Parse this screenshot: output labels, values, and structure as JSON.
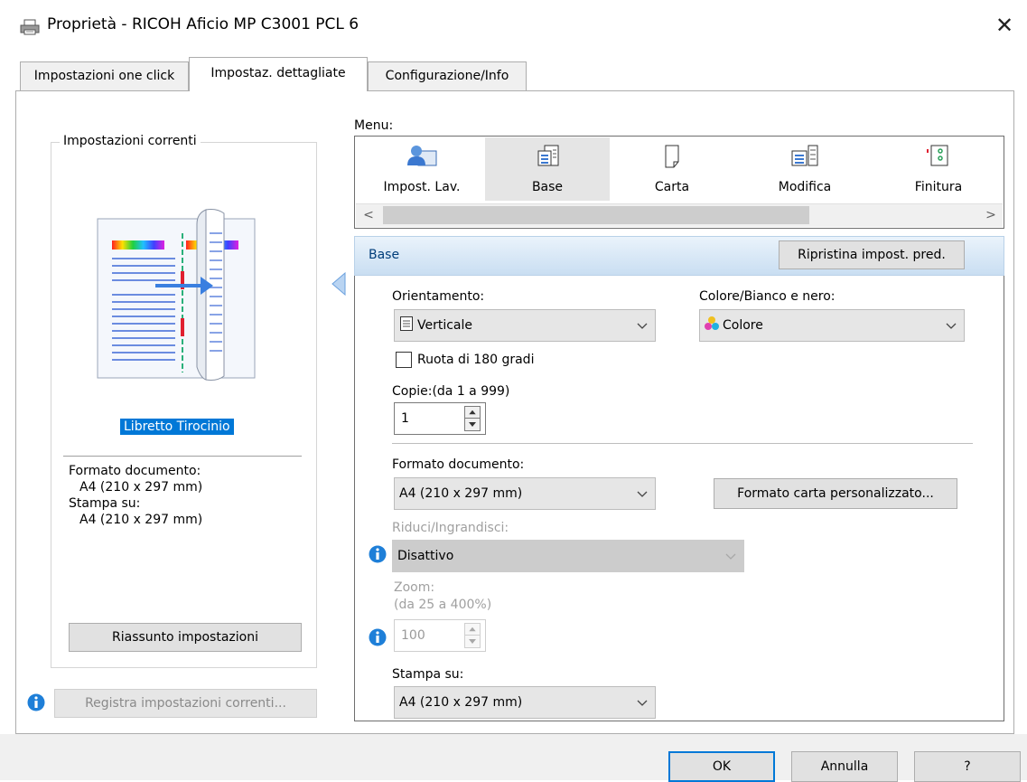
{
  "window": {
    "title": "Proprietà - RICOH Aficio MP C3001 PCL 6",
    "close_glyph": "✕"
  },
  "tabs": [
    {
      "label": "Impostazioni one click"
    },
    {
      "label": "Impostaz. dettagliate"
    },
    {
      "label": "Configurazione/Info"
    }
  ],
  "current_settings": {
    "legend": "Impostazioni correnti",
    "preset_name": "Libretto Tirocinio",
    "doc_size_label": "Formato documento:",
    "doc_size_value": "A4 (210 x 297 mm)",
    "print_on_label": "Stampa su:",
    "print_on_value": "A4 (210 x 297 mm)",
    "summary_button": "Riassunto impostazioni",
    "register_button": "Registra impostazioni correnti..."
  },
  "menu": {
    "label": "Menu:",
    "items": [
      {
        "label": "Impost. Lav.",
        "icon": "job-settings-icon"
      },
      {
        "label": "Base",
        "icon": "document-icon"
      },
      {
        "label": "Carta",
        "icon": "paper-icon"
      },
      {
        "label": "Modifica",
        "icon": "edit-icon"
      },
      {
        "label": "Finitura",
        "icon": "finishing-icon"
      }
    ],
    "scroll_left": "<",
    "scroll_right": ">"
  },
  "section": {
    "title": "Base",
    "reset_button": "Ripristina impost. pred."
  },
  "form": {
    "orientation_label": "Orientamento:",
    "orientation_value": "Verticale",
    "color_label": "Colore/Bianco e nero:",
    "color_value": "Colore",
    "rotate_label": "Ruota di 180 gradi",
    "copies_label": "Copie:(da 1 a 999)",
    "copies_value": "1",
    "doc_size_label": "Formato documento:",
    "doc_size_value": "A4 (210 x 297 mm)",
    "custom_size_button": "Formato carta personalizzato...",
    "reduce_label": "Riduci/Ingrandisci:",
    "reduce_value": "Disattivo",
    "zoom_label": "Zoom:",
    "zoom_range": "(da 25 a 400%)",
    "zoom_value": "100",
    "print_on_label": "Stampa su:",
    "print_on_value": "A4 (210 x 297 mm)"
  },
  "buttons": {
    "ok": "OK",
    "cancel": "Annulla",
    "help": "?"
  },
  "colors": {
    "accent": "#0078d7",
    "info_icon": "#1e7fd8"
  }
}
